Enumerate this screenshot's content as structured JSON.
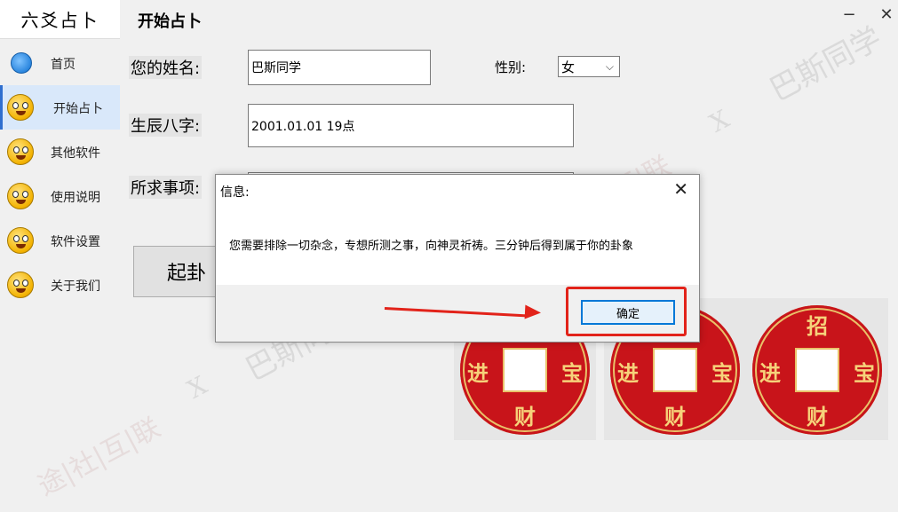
{
  "app": {
    "title": "六爻占卜"
  },
  "sidebar": {
    "items": [
      {
        "label": "首页",
        "icon": "yin-yang-icon"
      },
      {
        "label": "开始占卜",
        "icon": "surprised-face-icon"
      },
      {
        "label": "其他软件",
        "icon": "thinking-face-icon"
      },
      {
        "label": "使用说明",
        "icon": "glasses-face-icon"
      },
      {
        "label": "软件设置",
        "icon": "reading-face-icon"
      },
      {
        "label": "关于我们",
        "icon": "yawning-face-icon"
      }
    ],
    "active_index": 1
  },
  "page": {
    "title": "开始占卜",
    "window_controls": {
      "minimize": "−",
      "close": "✕"
    }
  },
  "form": {
    "name_label": "您的姓名:",
    "name_value": "巴斯同学",
    "gender_label": "性别:",
    "gender_value": "女",
    "birth_label": "生辰八字:",
    "birth_value": "2001.01.01 19点",
    "matter_label": "所求事项:",
    "start_button": "起卦"
  },
  "coins": [
    {
      "top": "",
      "left": "进",
      "right": "宝",
      "bottom": "财"
    },
    {
      "top": "",
      "left": "进",
      "right": "宝",
      "bottom": "财"
    },
    {
      "top": "招",
      "left": "进",
      "right": "宝",
      "bottom": "财"
    }
  ],
  "dialog": {
    "title": "信息:",
    "close": "✕",
    "message": "您需要排除一切杂念，专想所测之事，向神灵祈祷。三分钟后得到属于你的卦象",
    "ok_button": "确定"
  },
  "watermarks": {
    "text1": "巴斯同学",
    "text2": "X",
    "logo": "途|社|互|联"
  },
  "colors": {
    "coin_red": "#c8141a",
    "coin_gold": "#e9c26a",
    "highlight_red": "#e2231a",
    "active_nav_bg": "#d9e8fa",
    "button_focus_blue": "#0078d7"
  }
}
